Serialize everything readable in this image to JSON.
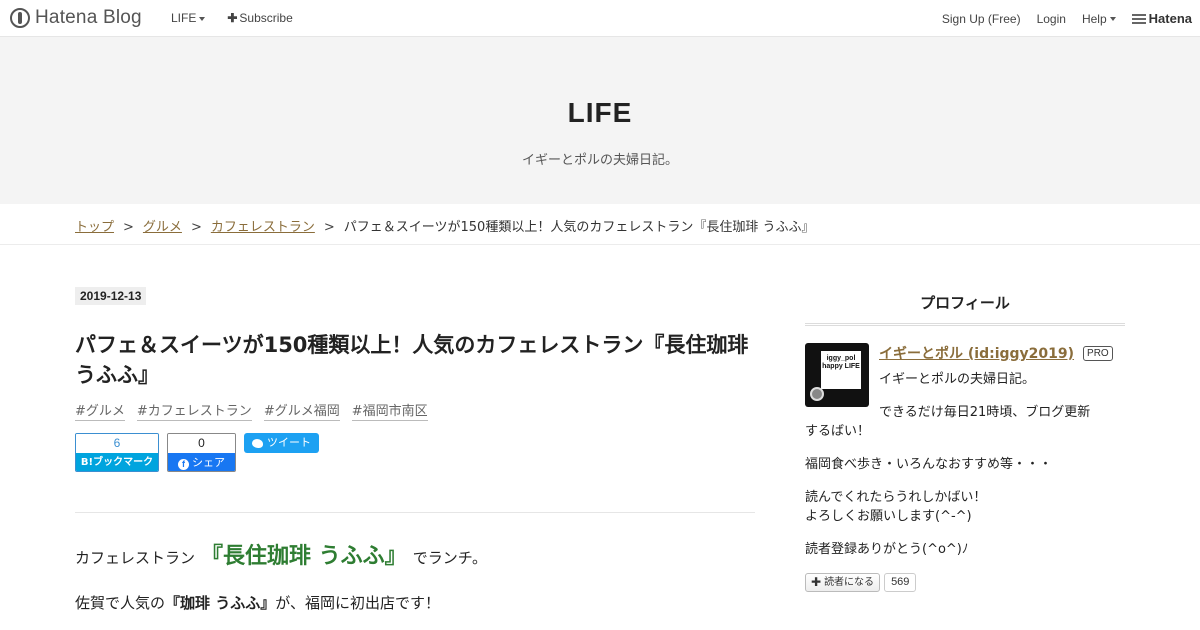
{
  "topbar": {
    "logo_text": "Hatena Blog",
    "blog_menu": "LIFE",
    "subscribe": "Subscribe",
    "signup": "Sign Up (Free)",
    "login": "Login",
    "help": "Help",
    "brand": "Hatena"
  },
  "header": {
    "title": "LIFE",
    "description": "イギーとポルの夫婦日記。"
  },
  "breadcrumb": {
    "items": [
      "トップ",
      "グルメ",
      "カフェレストラン"
    ],
    "separator": ">",
    "current": "パフェ＆スイーツが150種類以上！人気のカフェレストラン『長住珈琲 うふふ』"
  },
  "article": {
    "date": "2019-12-13",
    "title": "パフェ＆スイーツが150種類以上！人気のカフェレストラン『長住珈琲 うふふ』",
    "tags": [
      "#グルメ",
      "#カフェレストラン",
      "#グルメ福岡",
      "#福岡市南区"
    ],
    "share": {
      "hatena_count": "6",
      "hatena_label": "B!ブックマーク",
      "fb_count": "0",
      "fb_label": "シェア",
      "tweet_label": "ツイート"
    },
    "para1_pre": "カフェレストラン",
    "para1_shop": "『長住珈琲 うふふ』",
    "para1_post": "でランチ。",
    "para2_pre": "佐賀で人気の",
    "para2_bold": "『珈琲 うふふ』",
    "para2_post": "が、福岡に初出店です！"
  },
  "sidebar": {
    "title": "プロフィール",
    "avatar_text": "iggy_pol happy LIFE",
    "name": "イギーとポル (id:iggy2019)",
    "badge": "PRO",
    "line1": "イギーとポルの夫婦日記。",
    "line2a": "できるだけ毎日21時頃、ブログ更新",
    "line2b": "するばい！",
    "line3": "福岡食べ歩き・いろんなおすすめ等・・・",
    "line4a": "読んでくれたらうれしかばい！",
    "line4b": "よろしくお願いします(^-^)",
    "line5": "読者登録ありがとう(^o^)ﾉ",
    "reader_label": "読者になる",
    "reader_count": "569"
  },
  "colors": {
    "link": "#8a6d3b",
    "shop_name": "#2e7d32",
    "hatena_blue": "#00a4de",
    "facebook": "#1877f2",
    "twitter": "#1da1f2"
  }
}
